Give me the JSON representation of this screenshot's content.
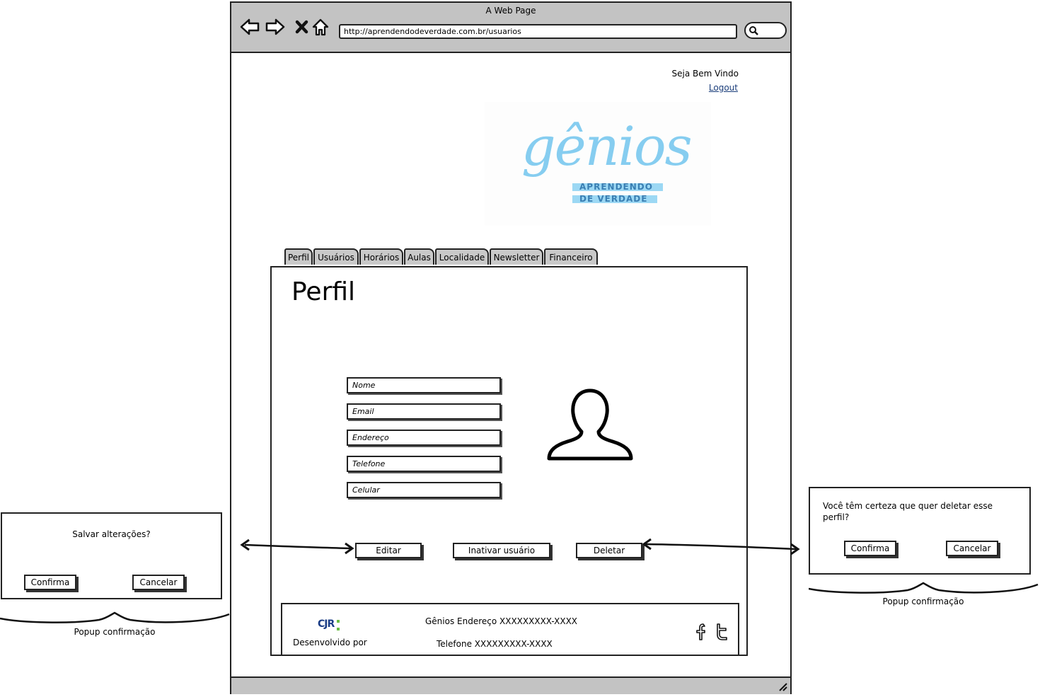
{
  "browser": {
    "window_title": "A Web Page",
    "url": "http://aprendendodeverdade.com.br/usuarios"
  },
  "header": {
    "welcome": "Seja Bem Vindo",
    "logout": "Logout"
  },
  "logo": {
    "word": "gênios",
    "line1": "APRENDENDO",
    "line2": "DE VERDADE"
  },
  "tabs": [
    "Perfil",
    "Usuários",
    "Horários",
    "Aulas",
    "Localidade",
    "Newsletter",
    "Financeiro"
  ],
  "panel": {
    "title": "Perfil",
    "fields": [
      "Nome",
      "Email",
      "Endereço",
      "Telefone",
      "Celular"
    ],
    "buttons": {
      "edit": "Editar",
      "deactivate": "Inativar usuário",
      "delete": "Deletar"
    }
  },
  "footer": {
    "logo_text": "CJR",
    "developed_by": "Desenvolvido por",
    "address": "Gênios Endereço XXXXXXXXX-XXXX",
    "phone": "Telefone XXXXXXXXX-XXXX"
  },
  "popup_save": {
    "question": "Salvar alterações?",
    "confirm": "Confirma",
    "cancel": "Cancelar",
    "caption": "Popup confirmação"
  },
  "popup_delete": {
    "question": "Você têm certeza que quer deletar esse perfil?",
    "confirm": "Confirma",
    "cancel": "Cancelar",
    "caption": "Popup confirmação"
  },
  "colors": {
    "chrome": "#c3c3c3",
    "logo": "#86cdf0",
    "link": "#1a3d7a"
  }
}
